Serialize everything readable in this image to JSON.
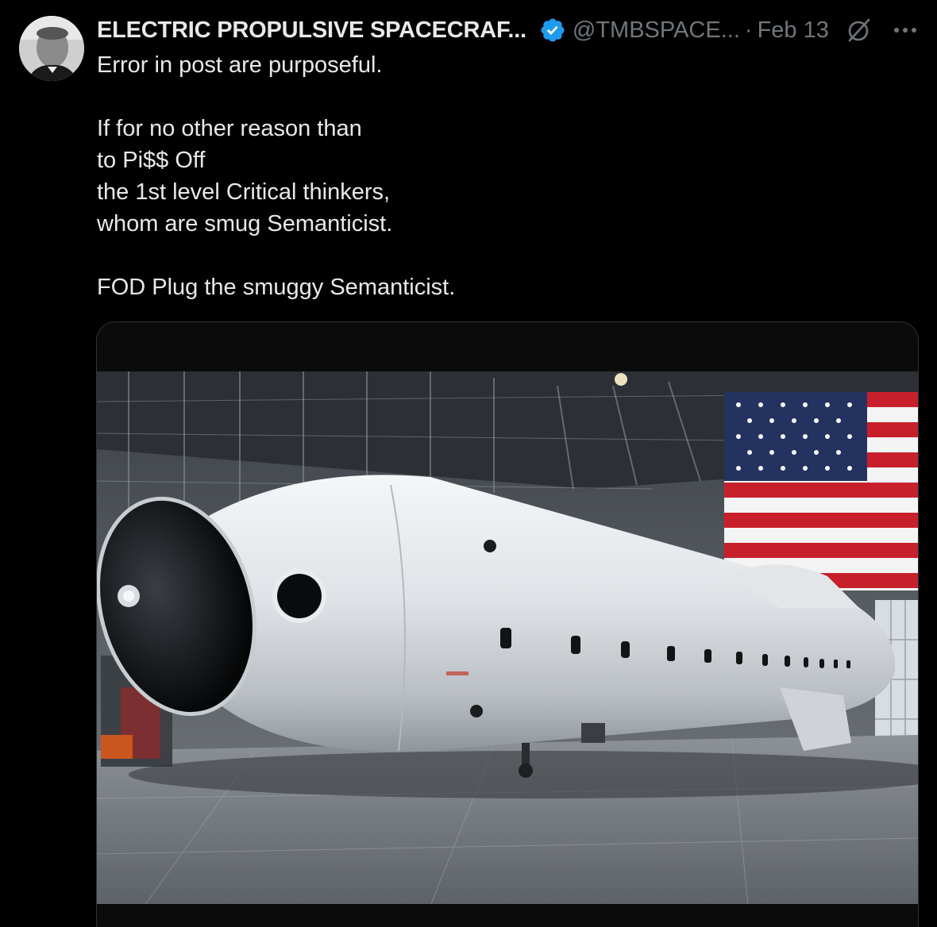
{
  "post": {
    "author": {
      "display_name": "ELECTRIC PROPULSIVE SPACECRAF...",
      "handle": "@TMBSPACE...",
      "verified": true,
      "verified_color": "#1d9bf0"
    },
    "separator": "·",
    "date": "Feb 13",
    "icons": {
      "verified": "verified-badge-icon",
      "grok": "grok-icon",
      "more": "more-options-icon"
    },
    "text_lines": [
      "Error in post are purposeful.",
      "",
      "If for no other reason than",
      "to Pi$$ Off",
      "the 1st level Critical thinkers,",
      "whom are smug Semanticist.",
      "",
      "FOD Plug the smuggy Semanticist."
    ],
    "media": {
      "type": "image"
    }
  },
  "colors": {
    "background": "#000000",
    "text": "#e7e9ea",
    "secondary_text": "#71767b",
    "border": "#2f3336"
  }
}
